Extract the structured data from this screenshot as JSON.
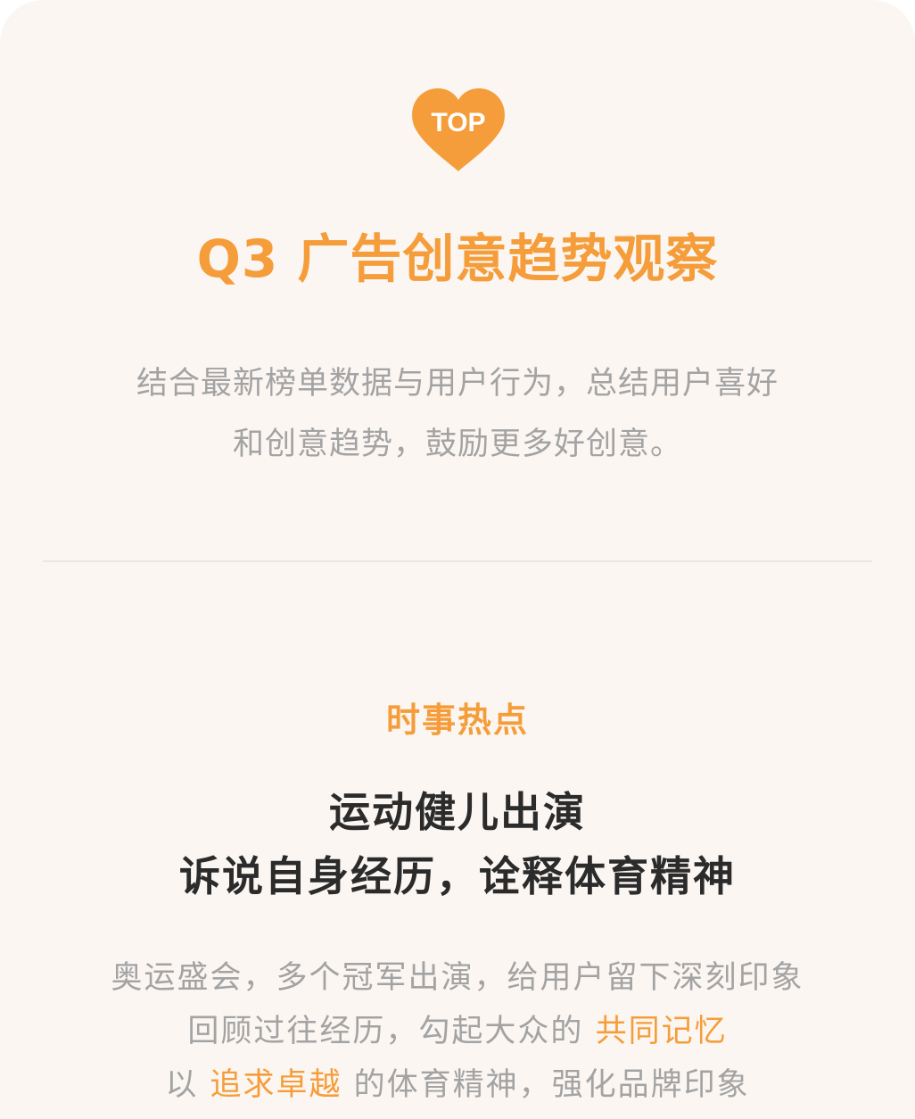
{
  "badge": {
    "icon": "heart-icon",
    "label": "TOP",
    "color": "#f59d3a"
  },
  "report_title": "Q3 广告创意趋势观察",
  "intro_lines": [
    "结合最新榜单数据与用户行为，总结用户喜好",
    "和创意趋势，鼓励更多好创意。"
  ],
  "section": {
    "tag": "时事热点",
    "headline": [
      "运动健儿出演",
      "诉说自身经历，诠释体育精神"
    ],
    "body": {
      "line1": "奥运盛会，多个冠军出演，给用户留下深刻印象",
      "line2_prefix": "回顾过往经历，勾起大众的",
      "line2_highlight": "共同记忆",
      "line3_prefix": "以",
      "line3_highlight": "追求卓越",
      "line3_suffix": "的体育精神，强化品牌印象"
    }
  },
  "colors": {
    "accent": "#f59d3a",
    "background": "#fbf6f2",
    "muted_text": "#a3a3a3",
    "dark_text": "#2b2b2b"
  }
}
